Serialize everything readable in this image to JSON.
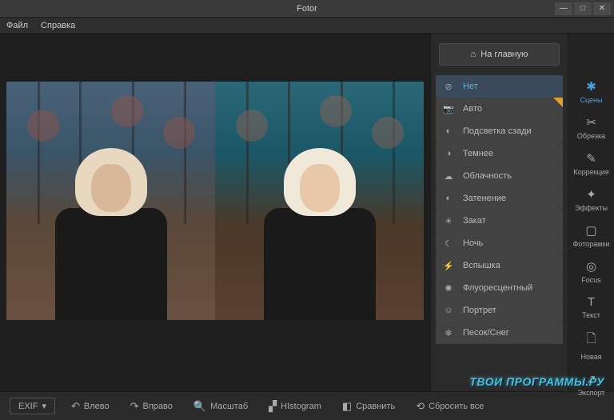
{
  "app_title": "Fotor",
  "menu": {
    "file": "Файл",
    "help": "Справка"
  },
  "window_controls": {
    "min": "—",
    "max": "□",
    "close": "✕"
  },
  "home_button": "На главную",
  "scenes": [
    {
      "icon": "⊘",
      "label": "Нет",
      "active": true
    },
    {
      "icon": "📷",
      "label": "Авто",
      "auto": true
    },
    {
      "icon": "◐",
      "label": "Подсветка сзади"
    },
    {
      "icon": "◑",
      "label": "Темнее"
    },
    {
      "icon": "☁",
      "label": "Облачность"
    },
    {
      "icon": "◐",
      "label": "Затенение"
    },
    {
      "icon": "☀",
      "label": "Закат"
    },
    {
      "icon": "☾",
      "label": "Ночь"
    },
    {
      "icon": "⚡",
      "label": "Вспышка"
    },
    {
      "icon": "✺",
      "label": "Флуоресцентный"
    },
    {
      "icon": "☺",
      "label": "Портрет"
    },
    {
      "icon": "❄",
      "label": "Песок/Снег"
    }
  ],
  "tools": [
    {
      "icon": "✱",
      "label": "Сцены",
      "active": true
    },
    {
      "icon": "✂",
      "label": "Обрезка"
    },
    {
      "icon": "✎",
      "label": "Коррекция"
    },
    {
      "icon": "✦",
      "label": "Эффекты"
    },
    {
      "icon": "▢",
      "label": "Фоторамки"
    },
    {
      "icon": "◎",
      "label": "Focus"
    },
    {
      "icon": "T",
      "label": "Текст"
    },
    {
      "icon": "🗋",
      "label": "Новая"
    },
    {
      "icon": "↗",
      "label": "Экспорт"
    }
  ],
  "bottom": {
    "exif": "EXIF",
    "left": "Влево",
    "right": "Вправо",
    "zoom": "Масштаб",
    "histogram": "HIstogram",
    "compare": "Сравнить",
    "reset": "Сбросить все"
  },
  "watermark": "ТВОИ ПРОГРАММЫ.РУ"
}
